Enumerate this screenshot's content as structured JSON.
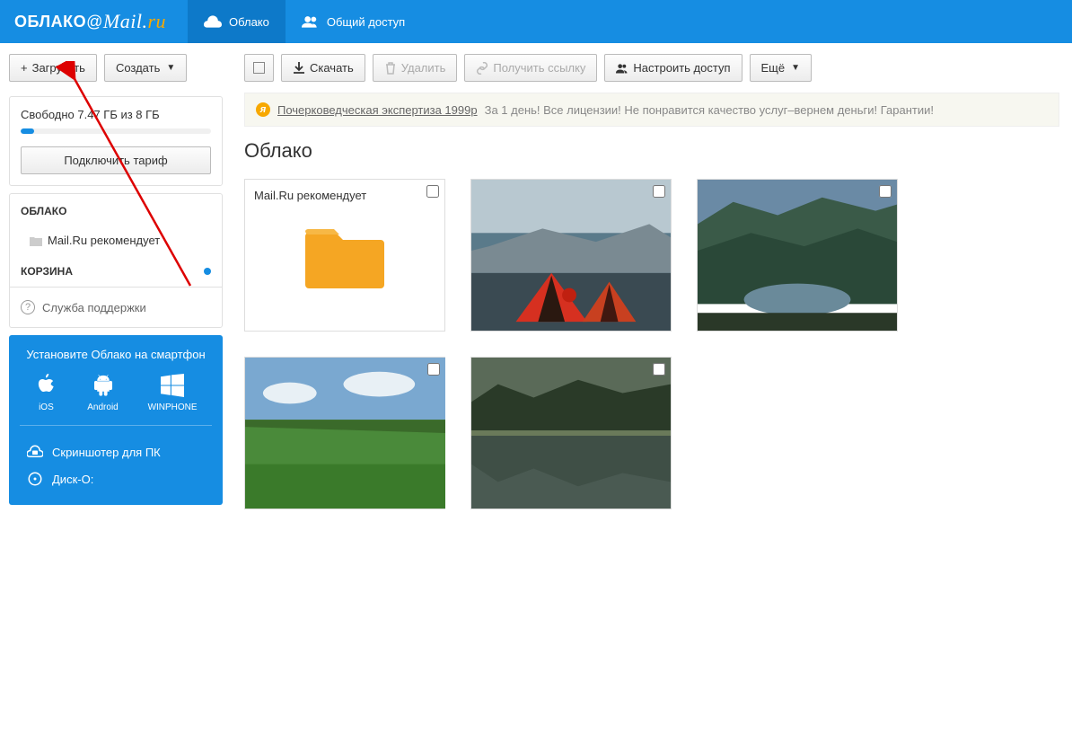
{
  "logo": {
    "text1": "ОБЛАКО",
    "at": "@",
    "mail": "Mail",
    "dot": ".",
    "ru": "ru"
  },
  "nav": {
    "cloud": "Облако",
    "shared": "Общий доступ"
  },
  "sidebar": {
    "upload": "Загрузить",
    "create": "Создать",
    "storage_text": "Свободно 7.47 ГБ из 8 ГБ",
    "connect_tariff": "Подключить тариф",
    "section_cloud": "ОБЛАКО",
    "recommends": "Mail.Ru рекомендует",
    "section_trash": "КОРЗИНА",
    "support": "Служба поддержки"
  },
  "promo": {
    "title": "Установите Облако на смартфон",
    "ios": "iOS",
    "android": "Android",
    "winphone": "WINPHONE",
    "screenshot": "Скриншотер для ПК",
    "disko": "Диск-О:"
  },
  "toolbar": {
    "download": "Скачать",
    "delete": "Удалить",
    "getlink": "Получить ссылку",
    "access": "Настроить доступ",
    "more": "Ещё"
  },
  "ad": {
    "link": "Почерковедческая экспертиза 1999р",
    "rest": "За 1 день! Все лицензии! Не понравится качество услуг–вернем деньги! Гарантии!"
  },
  "page_title": "Облако",
  "folder_name": "Mail.Ru рекомендует"
}
